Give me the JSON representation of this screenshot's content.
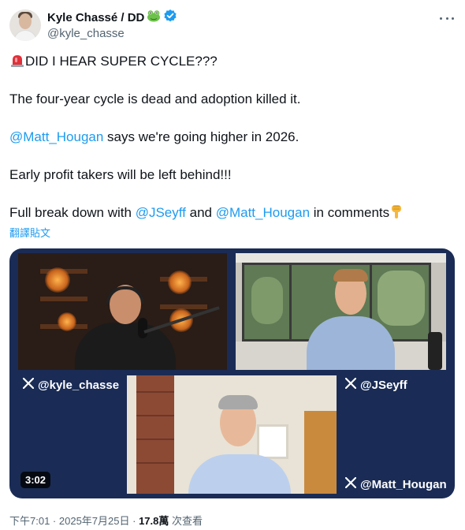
{
  "author": {
    "display_name": "Kyle Chassé / DD",
    "handle": "@kyle_chasse"
  },
  "tweet": {
    "line1_text": "DID I HEAR SUPER CYCLE???",
    "line2_text": "The four-year cycle is dead and adoption killed it.",
    "line3_mention": "@Matt_Hougan",
    "line3_text": " says we're going higher in 2026.",
    "line4_text": "Early profit takers will be left behind!!!",
    "line5_prefix": "Full break down with ",
    "line5_mention1": "@JSeyff",
    "line5_and": " and ",
    "line5_mention2": "@Matt_Hougan",
    "line5_suffix": " in comments",
    "translate_label": "翻譯貼文"
  },
  "video": {
    "label_1": "@kyle_chasse",
    "label_2": "@JSeyff",
    "label_3": "@Matt_Hougan",
    "duration": "3:02"
  },
  "meta": {
    "time": "下午7:01",
    "separator": " · ",
    "date": "2025年7月25日",
    "views_count": "17.8萬",
    "views_label": " 次查看"
  },
  "colors": {
    "link": "#1d9bf0",
    "secondary_text": "#536471",
    "video_background": "#1a2c55",
    "verified": "#1d9bf0"
  },
  "icons": [
    "siren-emoji-icon",
    "frog-emoji-icon",
    "verified-badge-icon",
    "more-icon",
    "x-logo-icon",
    "pointing-down-emoji-icon"
  ]
}
